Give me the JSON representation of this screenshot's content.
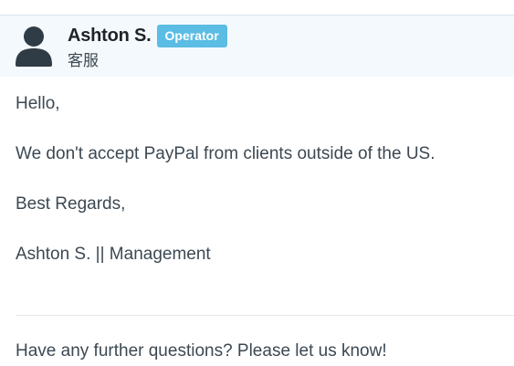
{
  "author": {
    "name": "Ashton S.",
    "badge": "Operator",
    "subtitle": "客服",
    "avatar_icon": "user-silhouette-icon"
  },
  "message": {
    "lines": [
      "Hello,",
      "We don't accept PayPal from clients outside of the US.",
      "Best Regards,",
      "Ashton S. || Management"
    ]
  },
  "footer": {
    "prompt": "Have any further questions? Please let us know!"
  },
  "colors": {
    "header_bg": "#f4f9fd",
    "badge_bg": "#5bbde3",
    "text": "#3c4852",
    "avatar": "#2f3b45"
  }
}
